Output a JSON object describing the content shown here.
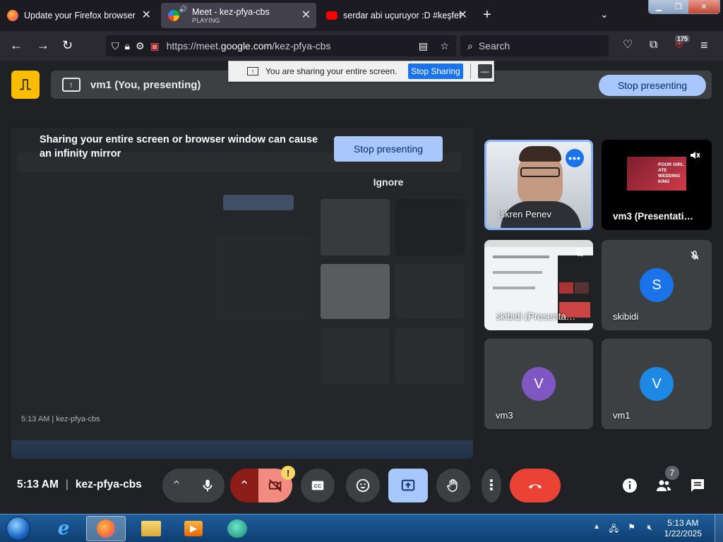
{
  "browser": {
    "tabs": [
      {
        "title": "Update your Firefox browser",
        "subtitle": "",
        "active": false,
        "favicon_color": "#ff7139"
      },
      {
        "title": "Meet - kez-pfya-cbs",
        "subtitle": "PLAYING",
        "active": true,
        "favicon_color": "#00ac47"
      },
      {
        "title": "serdar abi uçuruyor :D #keşfet",
        "subtitle": "",
        "active": false,
        "favicon_color": "#ff0000"
      }
    ],
    "url_prefix": "https://meet.",
    "url_domain": "google.com",
    "url_path": "/kez-pfya-cbs",
    "search_placeholder": "Search",
    "ublock_count": "175"
  },
  "share_popup": {
    "message": "You are sharing your entire screen.",
    "stop_label": "Stop Sharing",
    "minimize_label": "—"
  },
  "meet": {
    "presenter_title": "vm1 (You, presenting)",
    "stop_presenting_label": "Stop presenting",
    "warning": "Sharing your entire screen or browser window can cause an infinity mirror",
    "stop_presenting_main": "Stop presenting",
    "ignore_label": "Ignore",
    "mirror_footer": "5:13 AM  |  kez-pfya-cbs",
    "participants": [
      {
        "name": "Iskren Penev",
        "type": "camera",
        "speaking": true
      },
      {
        "name": "vm3 (Presentati…",
        "type": "presentation",
        "muted": true
      },
      {
        "name": "skibidi (Presenta…",
        "type": "presentation",
        "muted": true
      },
      {
        "name": "skibidi",
        "type": "avatar",
        "initial": "S",
        "color": "#1a73e8",
        "muted": true
      },
      {
        "name": "vm3",
        "type": "avatar",
        "initial": "V",
        "color": "#7e57c2"
      },
      {
        "name": "vm1",
        "type": "avatar",
        "initial": "V",
        "color": "#1e88e5"
      }
    ],
    "presentation_labels": {
      "top": "POOR GIRL ATE WEDDING KING"
    },
    "clock": "5:13 AM",
    "meeting_code": "kez-pfya-cbs",
    "camera_alert": "!",
    "people_count": "7"
  },
  "taskbar": {
    "time": "5:13 AM",
    "date": "1/22/2025"
  },
  "colors": {
    "accent": "#a8c7fa",
    "hangup": "#ea4335",
    "camera_off": "#f28b82",
    "camera_toggle": "#8c1d18",
    "present_active": "#a8c7fa"
  }
}
